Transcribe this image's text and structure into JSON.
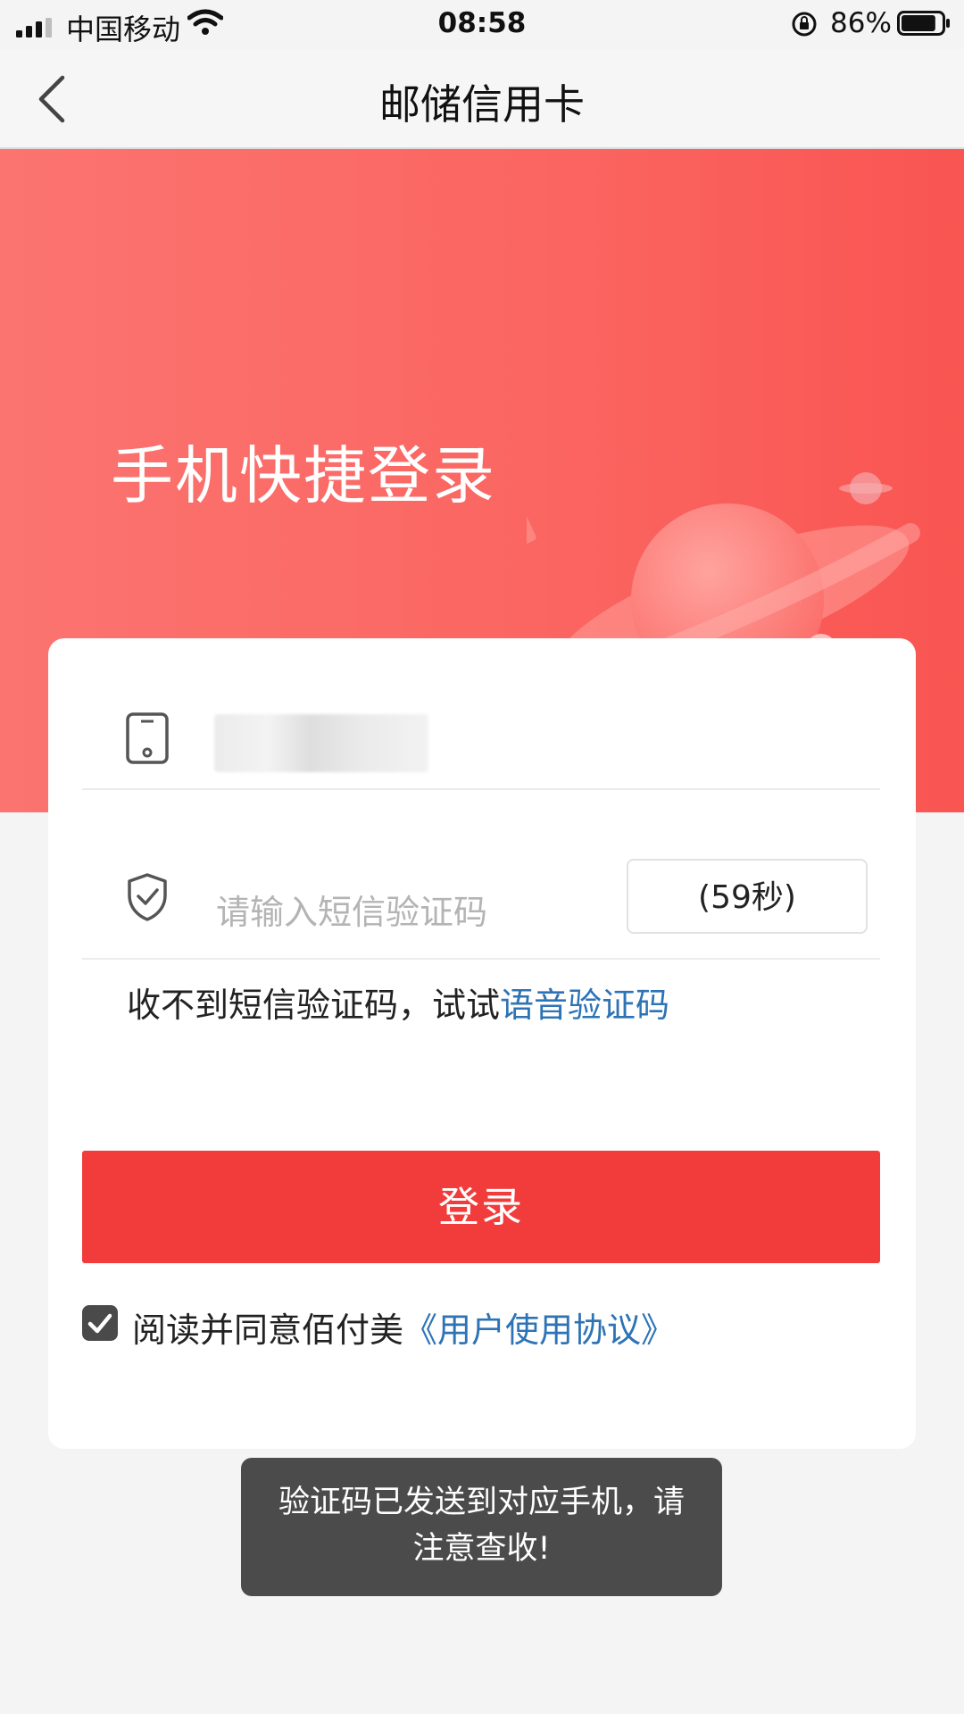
{
  "status_bar": {
    "carrier": "中国移动",
    "time": "08:58",
    "battery_percent": "86%",
    "battery_level": 0.86,
    "icons": [
      "signal-icon",
      "wifi-icon",
      "rotation-lock-icon",
      "battery-icon"
    ]
  },
  "nav": {
    "title": "邮储信用卡",
    "back_icon": "chevron-left-icon"
  },
  "hero": {
    "title": "手机快捷登录",
    "illustration": "planet-astronaut-illustration"
  },
  "form": {
    "phone_icon": "phone-icon",
    "code_icon": "shield-check-icon",
    "code_placeholder": "请输入短信验证码",
    "countdown": "(59秒)",
    "voice_hint_prefix": "收不到短信验证码，试试",
    "voice_link": "语音验证码",
    "login_button": "登录",
    "agree_checked": true,
    "agree_prefix": "阅读并同意佰付美",
    "agreement_link": "《用户使用协议》"
  },
  "toast": {
    "line1": "验证码已发送到对应手机，请",
    "line2": "注意查收!"
  },
  "colors": {
    "hero_bg": "#fb6662",
    "primary_red": "#f23c3c",
    "link_blue": "#2d73b5",
    "toast_bg": "#4b4b4b"
  }
}
